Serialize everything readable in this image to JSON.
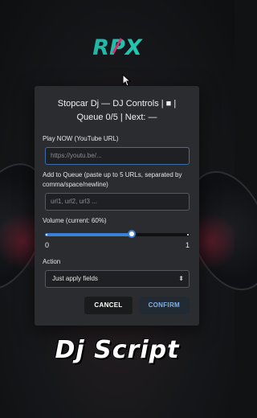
{
  "logo": {
    "text": "RPX"
  },
  "dialog": {
    "title": "Stopcar Dj — DJ Controls | ■ | Queue 0/5 | Next: —",
    "play_now": {
      "label": "Play NOW (YouTube URL)",
      "placeholder": "https://youtu.be/..."
    },
    "queue": {
      "label": "Add to Queue (paste up to 5 URLs, separated by comma/space/newline)",
      "placeholder": "url1, url2, url3 ..."
    },
    "volume": {
      "label": "Volume (current: 60%)",
      "value": 0.6,
      "min_label": "0",
      "max_label": "1"
    },
    "action": {
      "label": "Action",
      "selected": "Just apply fields",
      "chevron_icon": "chevron-updown-icon"
    },
    "cancel_label": "CANCEL",
    "confirm_label": "CONFIRM"
  },
  "caption": "Dj Script",
  "colors": {
    "accent": "#3b7fd6",
    "confirm_text": "#7fb2ea",
    "logo_teal": "#1fb5a6",
    "logo_pink": "#d6306b"
  }
}
